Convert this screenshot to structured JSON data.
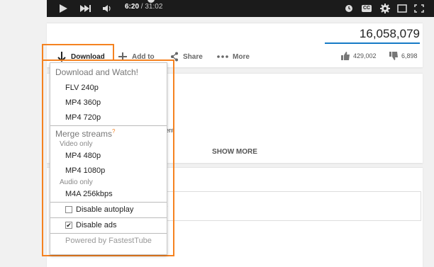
{
  "player": {
    "current_time": "6:20",
    "duration": "/ 31:02",
    "cc_label": "CC"
  },
  "stats": {
    "views": "16,058,079",
    "likes": "429,002",
    "dislikes": "6,898"
  },
  "actions": {
    "download": "Download",
    "add_to": "Add to",
    "share": "Share",
    "more": "More"
  },
  "description": {
    "show_more": "SHOW MORE",
    "partial_text": "ent",
    "partial_comment": "s"
  },
  "menu": {
    "heading_download": "Download and Watch!",
    "download_items": [
      "FLV 240p",
      "MP4 360p",
      "MP4 720p"
    ],
    "heading_merge": "Merge streams",
    "merge_help": "?",
    "video_only_label": "Video only",
    "video_items": [
      "MP4 480p",
      "MP4 1080p"
    ],
    "audio_only_label": "Audio only",
    "audio_items": [
      "M4A 256kbps"
    ],
    "option_autoplay": "Disable autoplay",
    "option_autoplay_checked": false,
    "option_ads": "Disable ads",
    "option_ads_checked": true,
    "powered_by": "Powered by FastestTube"
  },
  "colors": {
    "highlight": "#f58220",
    "view_bar": "#167ac6",
    "player_bg": "#1b1b1b"
  }
}
